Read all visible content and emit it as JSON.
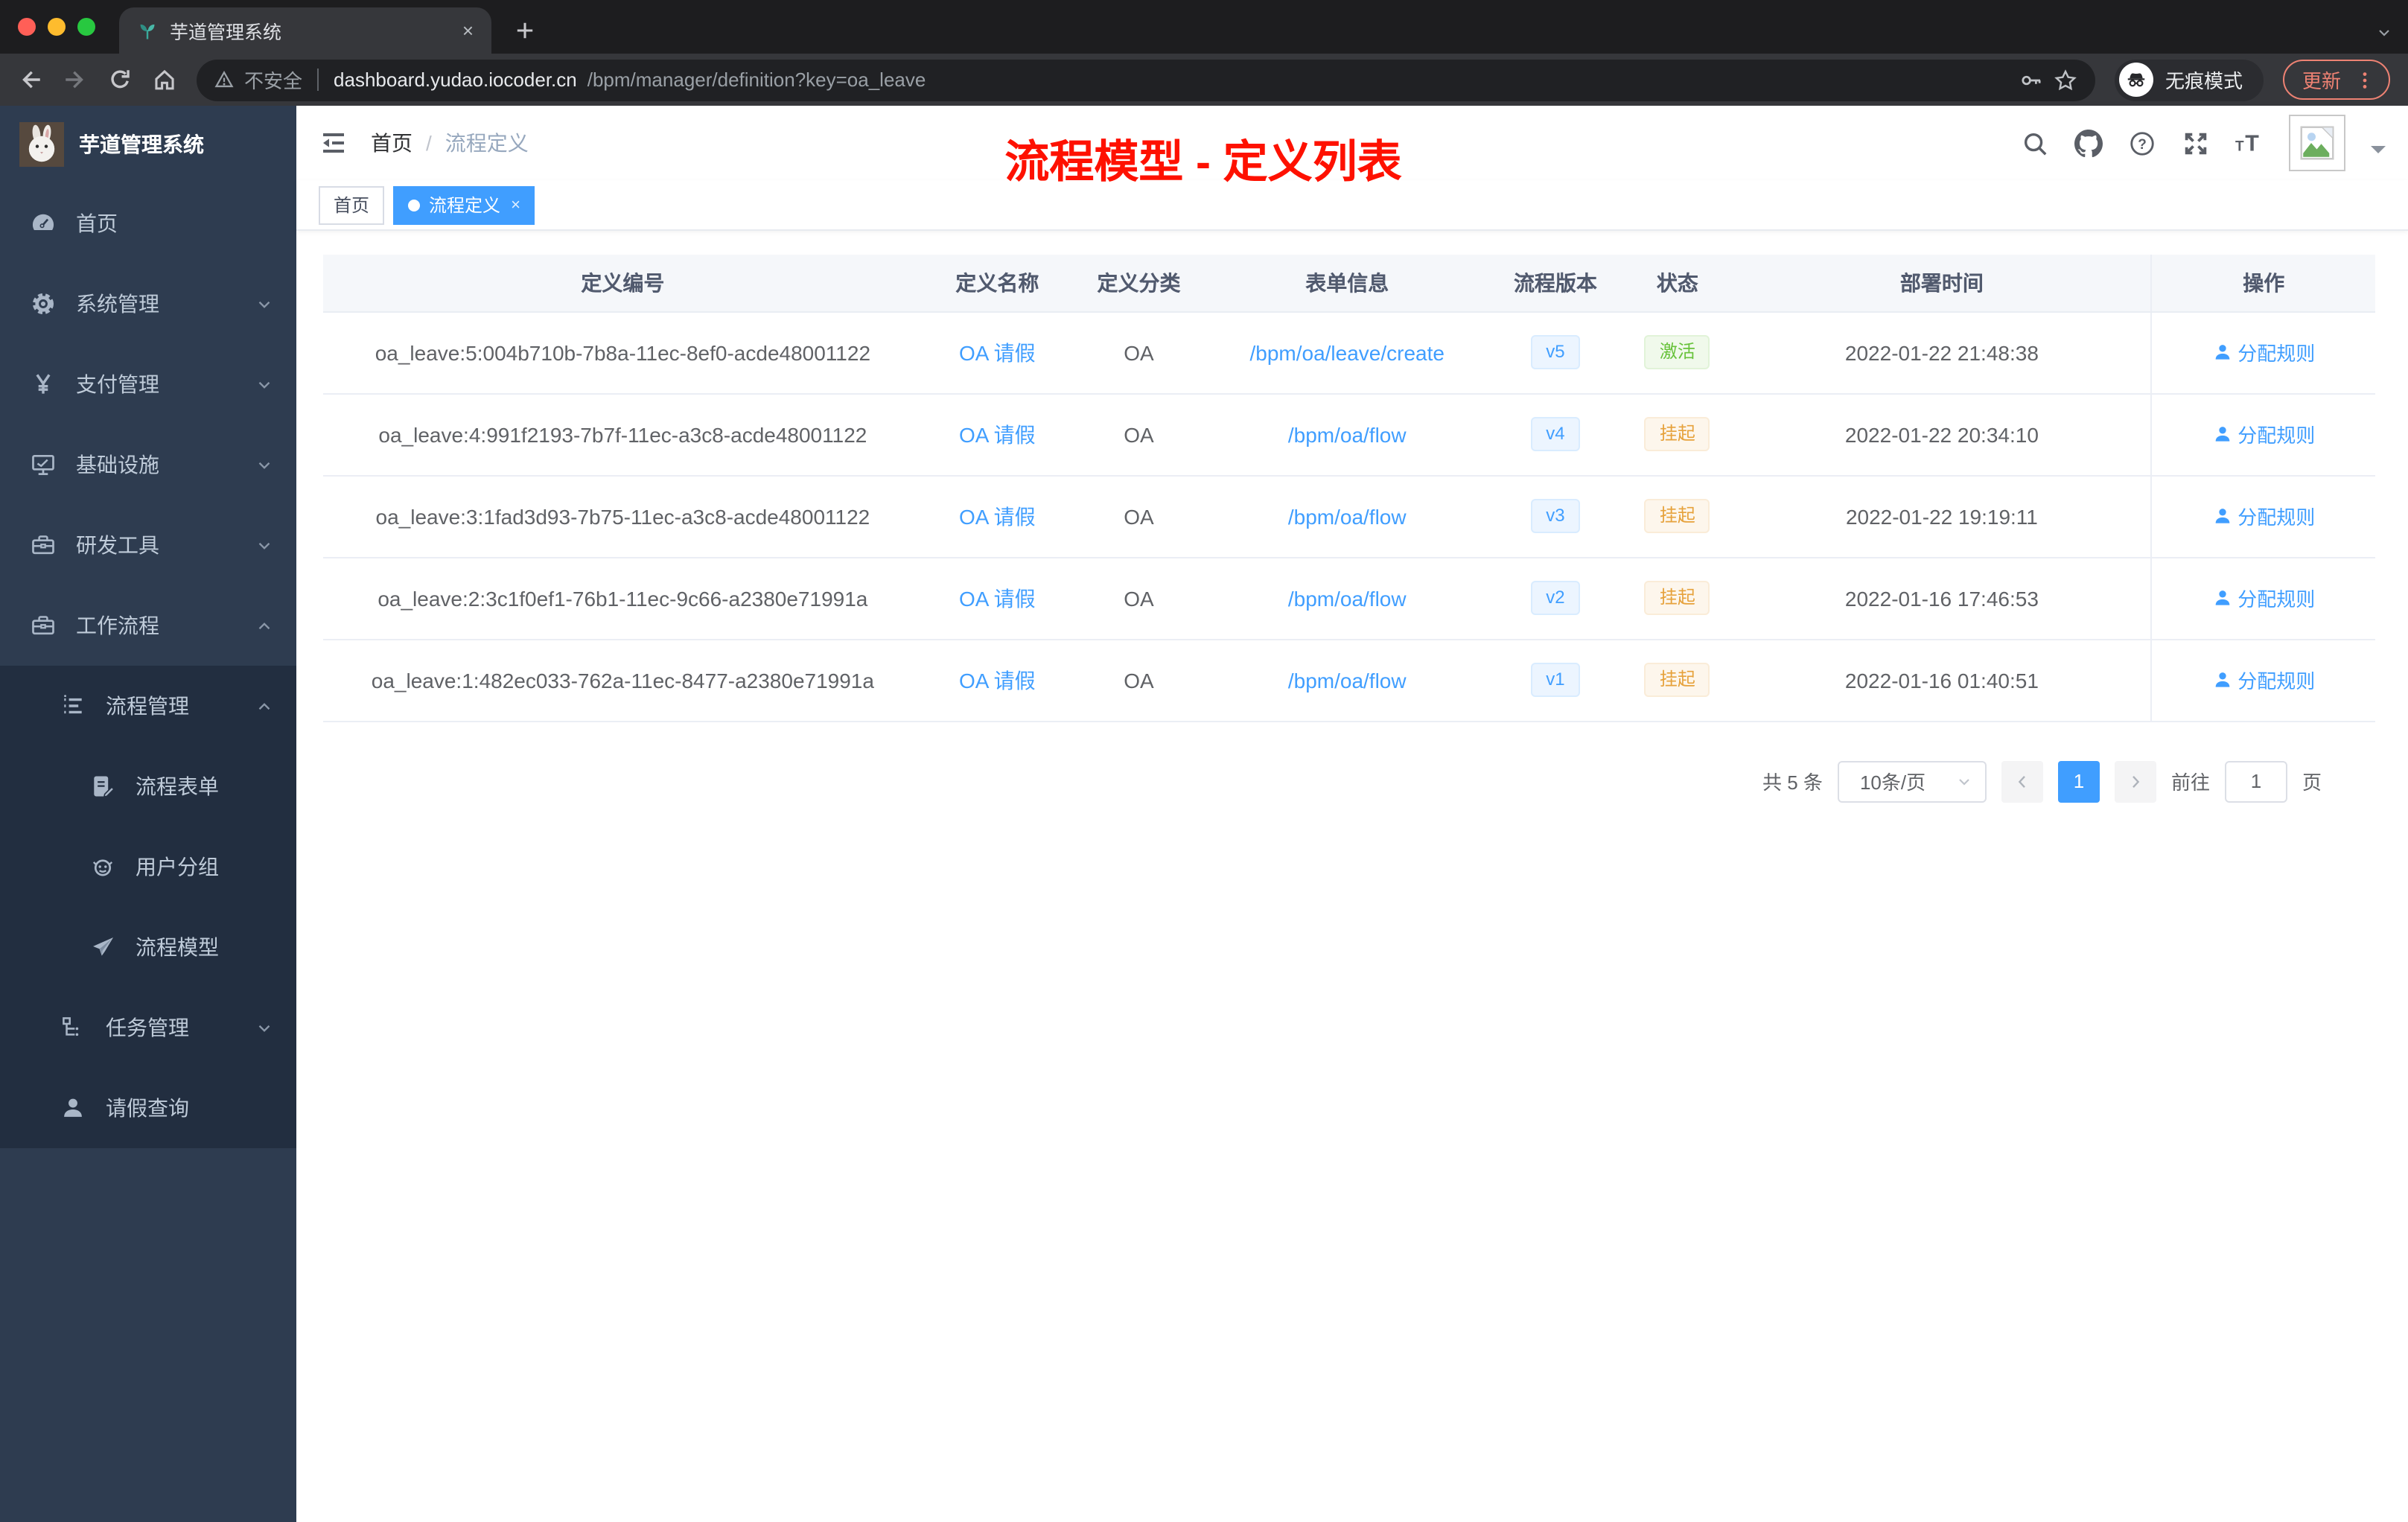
{
  "browser": {
    "tab": {
      "title": "芋道管理系统",
      "close_glyph": "×",
      "favicon": "sprout-icon"
    },
    "toolbar": {
      "security_warning": "不安全",
      "url_host": "dashboard.yudao.iocoder.cn",
      "url_path": "/bpm/manager/definition?key=oa_leave",
      "incognito_label": "无痕模式",
      "update_label": "更新"
    },
    "traffic_lights": [
      "#ff5f57",
      "#febc2e",
      "#28c840"
    ]
  },
  "sidebar": {
    "app_title": "芋道管理系统",
    "menu": [
      {
        "label": "首页",
        "icon": "dashboard-icon"
      },
      {
        "label": "系统管理",
        "icon": "gear-icon",
        "chevron": "down"
      },
      {
        "label": "支付管理",
        "icon": "yen-icon",
        "chevron": "down"
      },
      {
        "label": "基础设施",
        "icon": "monitor-icon",
        "chevron": "down"
      },
      {
        "label": "研发工具",
        "icon": "toolbox-icon",
        "chevron": "down"
      },
      {
        "label": "工作流程",
        "icon": "toolbox-icon",
        "chevron": "up"
      }
    ],
    "submenu": [
      {
        "label": "流程管理",
        "icon": "stream-icon",
        "chevron": "up",
        "level": 1
      },
      {
        "label": "流程表单",
        "icon": "form-icon",
        "level": 2
      },
      {
        "label": "用户分组",
        "icon": "users-icon",
        "level": 2
      },
      {
        "label": "流程模型",
        "icon": "paper-plane-icon",
        "level": 2
      },
      {
        "label": "任务管理",
        "icon": "tasks-icon",
        "chevron": "down",
        "level": 1
      },
      {
        "label": "请假查询",
        "icon": "user-icon",
        "level": 1
      }
    ]
  },
  "header": {
    "breadcrumb": [
      "首页",
      "流程定义"
    ],
    "separator": "/",
    "annotation": "流程模型 - 定义列表",
    "annotation_color": "#fe1100",
    "right_icons": [
      "search-icon",
      "github-icon",
      "question-icon",
      "fullscreen-icon",
      "font-size-icon"
    ]
  },
  "tags": [
    {
      "label": "首页",
      "active": false
    },
    {
      "label": "流程定义",
      "active": true,
      "closable": true,
      "close_glyph": "×"
    }
  ],
  "table": {
    "columns": [
      "定义编号",
      "定义名称",
      "定义分类",
      "表单信息",
      "流程版本",
      "状态",
      "部署时间",
      "操作"
    ],
    "rows": [
      {
        "id": "oa_leave:5:004b710b-7b8a-11ec-8ef0-acde48001122",
        "name": "OA 请假",
        "category": "OA",
        "form": "/bpm/oa/leave/create",
        "version": "v5",
        "status": "激活",
        "status_type": "success",
        "deploy_time": "2022-01-22 21:48:38",
        "action": "分配规则"
      },
      {
        "id": "oa_leave:4:991f2193-7b7f-11ec-a3c8-acde48001122",
        "name": "OA 请假",
        "category": "OA",
        "form": "/bpm/oa/flow",
        "version": "v4",
        "status": "挂起",
        "status_type": "warning",
        "deploy_time": "2022-01-22 20:34:10",
        "action": "分配规则"
      },
      {
        "id": "oa_leave:3:1fad3d93-7b75-11ec-a3c8-acde48001122",
        "name": "OA 请假",
        "category": "OA",
        "form": "/bpm/oa/flow",
        "version": "v3",
        "status": "挂起",
        "status_type": "warning",
        "deploy_time": "2022-01-22 19:19:11",
        "action": "分配规则"
      },
      {
        "id": "oa_leave:2:3c1f0ef1-76b1-11ec-9c66-a2380e71991a",
        "name": "OA 请假",
        "category": "OA",
        "form": "/bpm/oa/flow",
        "version": "v2",
        "status": "挂起",
        "status_type": "warning",
        "deploy_time": "2022-01-16 17:46:53",
        "action": "分配规则"
      },
      {
        "id": "oa_leave:1:482ec033-762a-11ec-8477-a2380e71991a",
        "name": "OA 请假",
        "category": "OA",
        "form": "/bpm/oa/flow",
        "version": "v1",
        "status": "挂起",
        "status_type": "warning",
        "deploy_time": "2022-01-16 01:40:51",
        "action": "分配规则"
      }
    ]
  },
  "pagination": {
    "total": "共 5 条",
    "page_size": "10条/页",
    "current_page": "1",
    "goto_label": "前往",
    "goto_value": "1",
    "unit": "页"
  },
  "colors": {
    "primary": "#409eff",
    "success": "#67c23a",
    "warning": "#e6a23c",
    "sidebar_bg": "#2e3c50",
    "submenu_bg": "#222e40"
  }
}
